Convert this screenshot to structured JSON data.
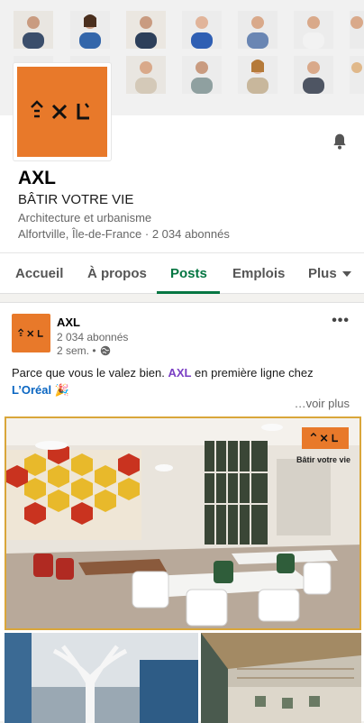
{
  "company": {
    "name": "AXL",
    "tagline": "BÂTIR VOTRE VIE",
    "industry": "Architecture et urbanisme",
    "location": "Alfortville, Île-de-France · 2 034 abonnés",
    "logo_text": "AXL"
  },
  "tabs": [
    "Accueil",
    "À propos",
    "Posts",
    "Emplois",
    "Plus"
  ],
  "active_tab": "Posts",
  "post": {
    "author": "AXL",
    "followers": "2 034 abonnés",
    "time": "2 sem. •",
    "text_prefix": "Parce que vous le valez bien. ",
    "mention_1": "AXL",
    "text_mid": " en première ligne chez",
    "mention_2": "L’Oréal",
    "emoji": "🎉",
    "see_more": "…voir plus",
    "overlay_text": "Bâtir votre vie"
  },
  "icons": [
    "bell-icon",
    "more-icon",
    "globe-icon",
    "caret-down-icon"
  ],
  "colors": {
    "accent": "#057642",
    "brand_orange": "#e8792a",
    "mention_purple": "#7a3fc4",
    "link_blue": "#0a66c2"
  }
}
